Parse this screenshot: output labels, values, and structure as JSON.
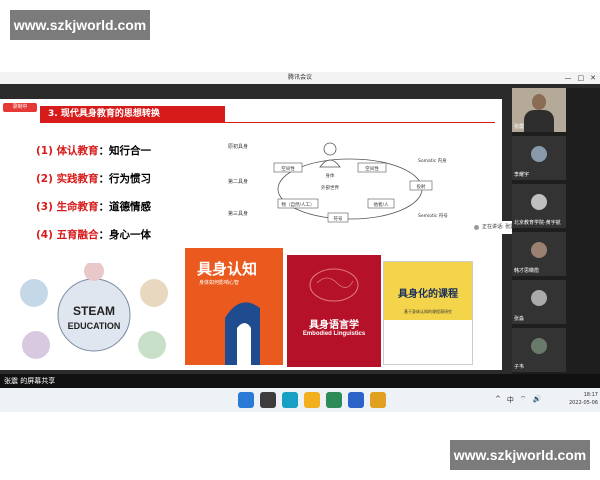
{
  "watermarks": {
    "top": "www.szkjworld.com",
    "bottom": "www.szkjworld.com"
  },
  "window": {
    "title": "腾讯会议",
    "controls": [
      "—",
      "□",
      "✕"
    ]
  },
  "slide": {
    "recording_label": "录制中",
    "heading": "3. 现代具身教育的思想转换",
    "points": [
      {
        "num": "(1) ",
        "key": "体认教育",
        "text": "：知行合一"
      },
      {
        "num": "(2) ",
        "key": "实践教育",
        "text": "：行为惯习"
      },
      {
        "num": "(3) ",
        "key": "生命教育",
        "text": "：道德情感"
      },
      {
        "num": "(4) ",
        "key": "五育融合",
        "text": "：身心一体"
      }
    ],
    "steam": {
      "line1": "STEAM",
      "line2": "EDUCATION"
    },
    "diagram": {
      "rows": [
        "原初具身",
        "第二具身",
        "第三具身"
      ],
      "boxes": [
        "空间性",
        "身体",
        "空间性",
        "外部世界",
        "物（自然/人工）",
        "他者/人",
        "符号",
        "投射"
      ],
      "right_labels": [
        "Somatic 内身",
        "Semiotic 符号"
      ]
    },
    "books": [
      {
        "title": "具身认知",
        "subtitle": "身体如何影响心智"
      },
      {
        "title": "具身语言学",
        "subtitle": "Embodied Linguistics"
      },
      {
        "title": "具身化的课程",
        "subtitle": "基于身体认知的课程观研究"
      }
    ]
  },
  "participants": [
    {
      "name": "张震",
      "camera": true
    },
    {
      "name": "李耀宇",
      "camera": false
    },
    {
      "name": "北京教育学院-黄宇航",
      "camera": false
    },
    {
      "name": "韩才思橄榄",
      "camera": false
    },
    {
      "name": "张淼",
      "camera": false
    },
    {
      "name": "子韦",
      "camera": false
    }
  ],
  "speaking": {
    "label": "正在讲话: 张震;"
  },
  "share_bar": {
    "label": "张震 的屏幕共享"
  },
  "taskbar": {
    "tray": [
      "^",
      "中",
      "⌔",
      "🔊"
    ],
    "time": "18:17",
    "date": "2022-05-06"
  },
  "colors": {
    "accent_red": "#d71a1a",
    "watermark": "#7b7b7b",
    "meeting_bg": "#2b2b2b"
  }
}
